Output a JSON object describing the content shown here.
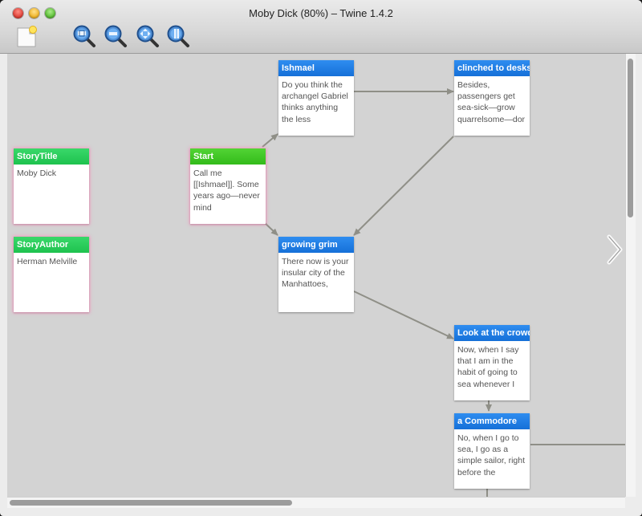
{
  "window": {
    "title": "Moby Dick (80%) – Twine 1.4.2"
  },
  "toolbar": {
    "tools": [
      {
        "name": "new-passage-button",
        "icon": "new-document-icon"
      },
      {
        "name": "zoom-in-button",
        "icon": "zoom-in-icon"
      },
      {
        "name": "zoom-out-button",
        "icon": "zoom-out-icon"
      },
      {
        "name": "zoom-fit-button",
        "icon": "zoom-fit-icon"
      },
      {
        "name": "zoom-actual-button",
        "icon": "zoom-actual-icon"
      }
    ]
  },
  "colors": {
    "header_blue": "#1a78e2",
    "header_green": "#2bd25f",
    "header_start": "#44c826",
    "link_arrow": "#8f8f87",
    "canvas": "#d3d3d3"
  },
  "passages": [
    {
      "id": "storytitle",
      "title": "StoryTitle",
      "body": "Moby Dick",
      "header": "green"
    },
    {
      "id": "storyauthor",
      "title": "StoryAuthor",
      "body": "Herman Melville",
      "header": "green"
    },
    {
      "id": "start",
      "title": "Start",
      "body": "Call me [[Ishmael]]. Some years ago—never mind",
      "header": "lime"
    },
    {
      "id": "ishmael",
      "title": "Ishmael",
      "body": "Do you think the archangel Gabriel thinks anything the less",
      "header": "blue"
    },
    {
      "id": "clinched",
      "title": "clinched to desks",
      "body": "Besides, passengers get sea-sick—grow quarrelsome—dor",
      "header": "blue"
    },
    {
      "id": "grim",
      "title": "growing grim",
      "body": "There now is your insular city of the Manhattoes,",
      "header": "blue"
    },
    {
      "id": "crowd",
      "title": "Look at the crowds",
      "body": "Now, when I say that I am in the habit of going to sea whenever I",
      "header": "blue"
    },
    {
      "id": "commodore",
      "title": "a Commodore",
      "body": "No, when I go to sea, I go as a simple sailor, right before the",
      "header": "blue"
    }
  ],
  "scroll": {
    "horizontal_fraction": 0.46,
    "vertical_fraction": 0.36
  }
}
